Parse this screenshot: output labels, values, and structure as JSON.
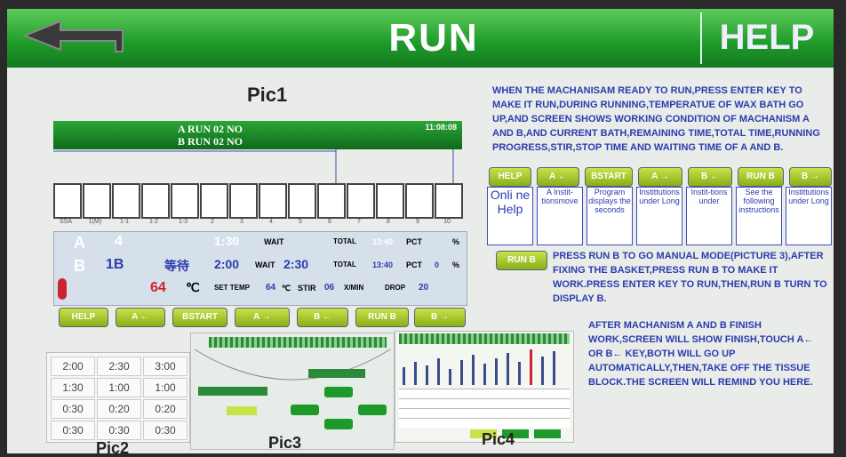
{
  "header": {
    "title": "RUN",
    "help_label": "HELP"
  },
  "labels": {
    "pic1": "Pic1",
    "pic2": "Pic2",
    "pic3": "Pic3",
    "pic4": "Pic4"
  },
  "status": {
    "row_a": "A   RUN   02 NO",
    "row_b": "B   RUN   02 NO",
    "clock": "11:08:08"
  },
  "baths": [
    "SSA",
    "1(M)",
    "1-1",
    "1-2",
    "1-3",
    "2",
    "3",
    "4",
    "5",
    "6",
    "7",
    "8",
    "9",
    "10"
  ],
  "panel": {
    "a": {
      "letter": "A",
      "bath": "4",
      "time": "1:30",
      "state": "WAIT",
      "total_label": "TOTAL",
      "total": "13:40",
      "pct_label": "PCT",
      "pct_unit": "%"
    },
    "b": {
      "letter": "B",
      "bath": "1B",
      "mode": "等待",
      "time": "2:00",
      "state": "WAIT",
      "wait": "2:30",
      "total_label": "TOTAL",
      "total": "13:40",
      "pct_label": "PCT",
      "pct": "0",
      "pct_unit": "%"
    },
    "temp": {
      "value": "64",
      "unit": "℃",
      "set_label": "SET TEMP",
      "set": "64",
      "set_unit": "℃",
      "stir_label": "STIR",
      "stir": "06",
      "stir_unit": "X/MIN",
      "drop_label": "DROP",
      "drop": "20"
    }
  },
  "buttons": [
    "HELP",
    "A ←",
    "BSTART",
    "A →",
    "B ←",
    "RUN B",
    "B →"
  ],
  "right_buttons": [
    "HELP",
    "A ←",
    "BSTART",
    "A →",
    "B ←",
    "RUN B",
    "B →"
  ],
  "run_b_button": "RUN B",
  "texts": {
    "intro": "WHEN THE MACHANISAM READY TO RUN,PRESS ENTER KEY TO MAKE IT RUN,DURING RUNNING,TEMPERATUE OF WAX BATH GO UP,AND SCREEN SHOWS WORKING CONDITION OF MACHANISM A AND B,AND CURRENT BATH,REMAINING TIME,TOTAL TIME,RUNNING PROGRESS,STIR,STOP TIME AND WAITING TIME OF A AND B.",
    "runb": "PRESS RUN B TO GO MANUAL MODE(PICTURE 3),AFTER FIXING THE BASKET,PRESS RUN B TO MAKE IT WORK.PRESS ENTER KEY TO RUN,THEN,RUN B TURN TO DISPLAY B.",
    "finish": "AFTER MACHANISM A AND B FINISH WORK,SCREEN WILL SHOW FINISH,TOUCH A← OR B← KEY,BOTH WILL GO UP AUTOMATICALLY,THEN,TAKE OFF THE TISSUE BLOCK.THE SCREEN WILL REMIND YOU HERE."
  },
  "small_boxes": [
    "Onli ne Help",
    "A Instit-tionsmove",
    "Program displays the seconds",
    "Instittutions under Long",
    "Instit-tions under",
    "See the following instructions",
    "Instittutions under Long"
  ],
  "pic2_cells": [
    "2:00",
    "2:30",
    "3:00",
    "1:30",
    "1:00",
    "1:00",
    "0:30",
    "0:20",
    "0:20",
    "0:30",
    "0:30",
    "0:30"
  ]
}
